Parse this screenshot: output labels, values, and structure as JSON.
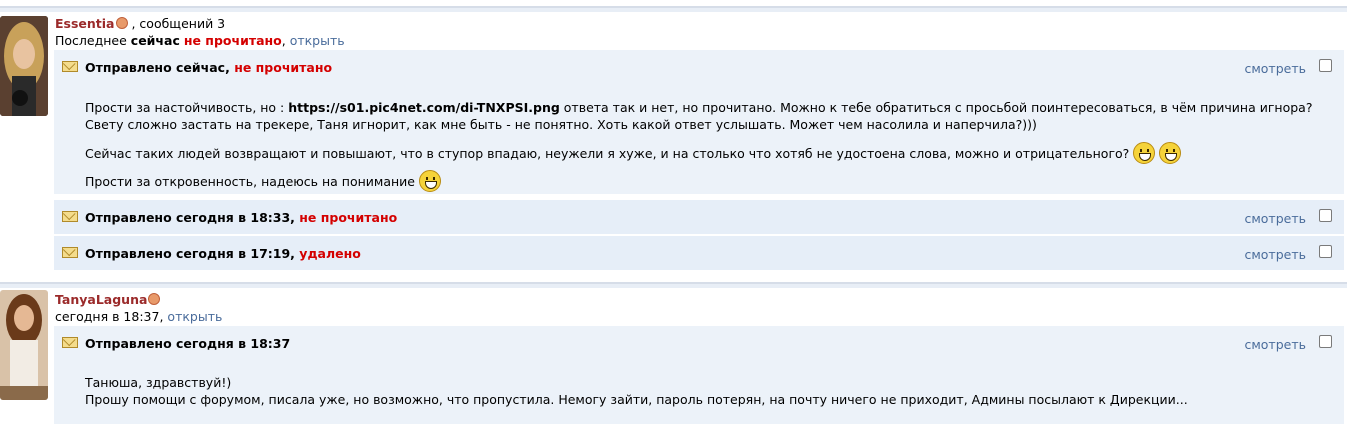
{
  "threads": [
    {
      "user": "Essentia",
      "meta": ", сообщений 3",
      "last_label": "Последнее",
      "last_time": "сейчас",
      "last_status": "не прочитано",
      "open_link": "открыть",
      "messages": [
        {
          "sent": "Отправлено сейчас,",
          "status": "не прочитано",
          "view": "смотреть",
          "body": {
            "p1_a": "Прости за настойчивость, но : ",
            "p1_url": "https://s01.pic4net.com/di-TNXPSI.png",
            "p1_b": " ответа так и нет, но прочитано. Можно к тебе обратиться с просьбой поинтересоваться, в чём причина игнора? Свету сложно застать на трекере, Таня игнорит, как мне быть - не понятно. Хоть какой ответ услышать. Может чем насолила и наперчила?)))",
            "p2": "Сейчас таких людей возвращают и повышают, что в ступор впадаю, неужели я хуже, и на столько что хотяб не удостоена слова, можно и отрицательного?",
            "p3": "Прости за откровенность, надеюсь на понимание"
          }
        },
        {
          "sent": "Отправлено сегодня в 18:33,",
          "status": "не прочитано",
          "view": "смотреть"
        },
        {
          "sent": "Отправлено сегодня в 17:19,",
          "status": "удалено",
          "view": "смотреть"
        }
      ]
    },
    {
      "user": "TanyaLaguna",
      "last_time": "сегодня в 18:37,",
      "open_link": "открыть",
      "messages": [
        {
          "sent": "Отправлено сегодня в 18:37",
          "view": "смотреть",
          "body": {
            "l1": "Танюша, здравствуй!)",
            "l2": "Прошу помощи с форумом, писала уже, но возможно, что пропустила. Немогу зайти, пароль потерян, на почту ничего не приходит, Админы посылают к Дирекции..."
          }
        }
      ]
    }
  ]
}
